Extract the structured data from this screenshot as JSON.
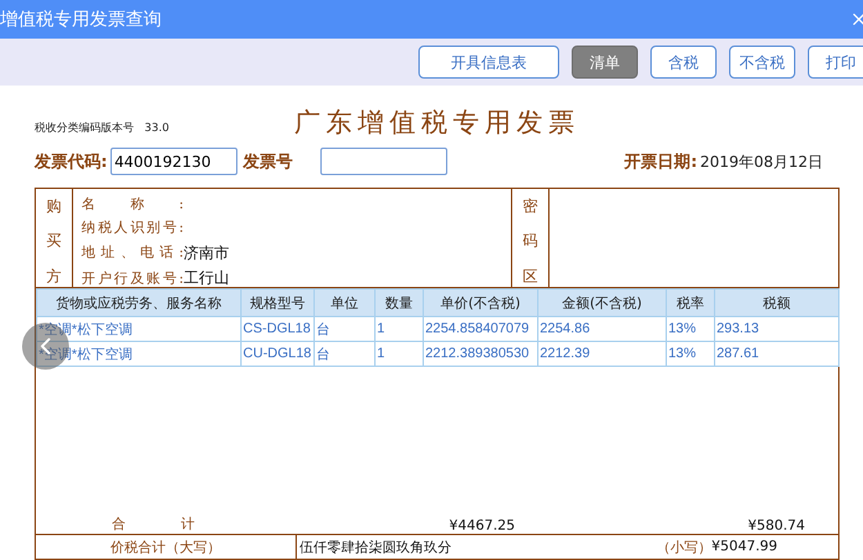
{
  "window": {
    "title": "增值税专用发票查询"
  },
  "toolbar": [
    {
      "label": "开具信息表",
      "selected": false
    },
    {
      "label": "清单",
      "selected": true
    },
    {
      "label": "含税",
      "selected": false
    },
    {
      "label": "不含税",
      "selected": false
    },
    {
      "label": "打印",
      "selected": false
    }
  ],
  "invoice": {
    "version_label": "税收分类编码版本号",
    "version": "33.0",
    "title": "广东增值税专用发票",
    "code_label": "发票代码:",
    "code": "4400192130",
    "number_label": "发票号",
    "date_label": "开票日期:",
    "date": "2019年08月12日",
    "buyer": {
      "side_label": "购买方",
      "cipher_label": "密码区",
      "fields": [
        {
          "label": "名称:"
        },
        {
          "label": "纳税人识别号:"
        },
        {
          "label": "地址、电话:",
          "value": "济南市"
        },
        {
          "label": "开户行及账号:",
          "value": "工行山"
        }
      ]
    },
    "goods": {
      "columns": [
        "货物或应税劳务、服务名称",
        "规格型号",
        "单位",
        "数量",
        "单价(不含税)",
        "金额(不含税)",
        "税率",
        "税额"
      ],
      "rows": [
        [
          "*空调*松下空调",
          "CS-DGL18",
          "台",
          "1",
          "2254.858407079",
          "2254.86",
          "13%",
          "293.13"
        ],
        [
          "*空调*松下空调",
          "CU-DGL18",
          "台",
          "1",
          "2212.389380530",
          "2212.39",
          "13%",
          "287.61"
        ]
      ]
    },
    "total_label": "合计",
    "total_amount": "¥4467.25",
    "total_tax": "¥580.74",
    "grand_label": "价税合计（大写）",
    "grand_words": "伍仟零肆拾柒圆玖角玖分",
    "grand_small_label": "（小写）",
    "grand_small": "¥5047.99"
  }
}
